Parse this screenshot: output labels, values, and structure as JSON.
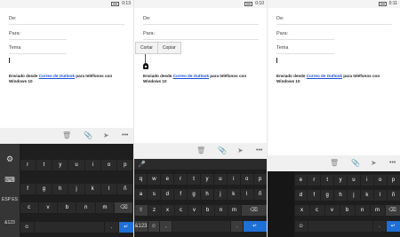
{
  "status": {
    "time_1": "0:13",
    "time_2": "0:10",
    "time_3": "0:11"
  },
  "form": {
    "from_label": "De:",
    "to_label": "Para:",
    "subject_label": "Tema"
  },
  "signature": {
    "prefix": "Enviado desde ",
    "link": "Correo de Outlook",
    "suffix": " para teléfonos con Windows 10"
  },
  "context_menu": {
    "cut": "Cortar",
    "copy": "Copiar"
  },
  "appbar_icons": [
    "trash-icon",
    "paperclip-icon",
    "send-icon",
    "more-icon"
  ],
  "keyboard": {
    "row1": [
      "q",
      "w",
      "e",
      "r",
      "t",
      "y",
      "u",
      "i",
      "o",
      "p"
    ],
    "row2": [
      "a",
      "s",
      "d",
      "f",
      "g",
      "h",
      "j",
      "k",
      "l",
      "ñ"
    ],
    "row3": [
      "z",
      "x",
      "c",
      "v",
      "b",
      "n",
      "m"
    ],
    "symbols_key": "&123",
    "lang_key": "ESP ES",
    "emoji_key": "☺",
    "comma_key": ",",
    "period_key": ".",
    "shift_key": "⇧",
    "backspace_key": "⌫",
    "enter_key": "↵"
  }
}
